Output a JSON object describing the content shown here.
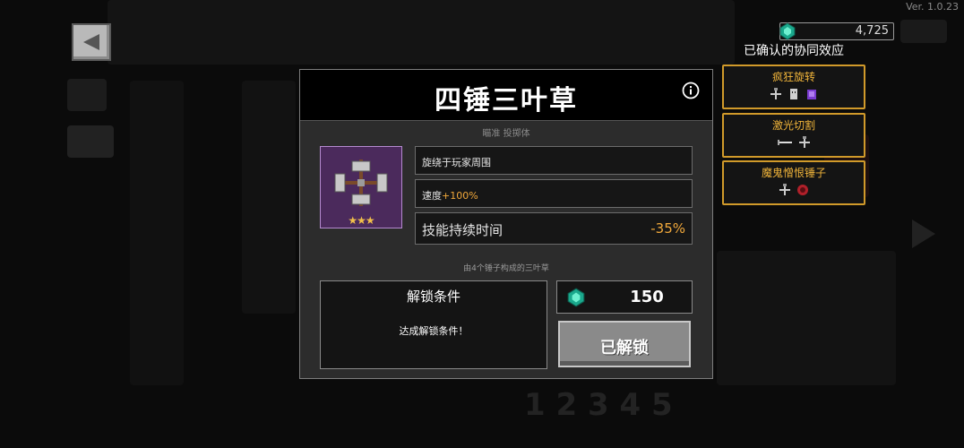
{
  "version": "Ver. 1.0.23",
  "back_button_icon": "back-arrow-icon",
  "currency": {
    "icon": "gem-icon",
    "amount": "4,725"
  },
  "synergy_panel": {
    "title": "已确认的协同效应",
    "items": [
      {
        "name": "疯狂旋转",
        "icons": [
          "hammer-icon",
          "ghost-icon",
          "purple-orb-icon"
        ]
      },
      {
        "name": "激光切割",
        "icons": [
          "laser-icon",
          "hammer-icon"
        ]
      },
      {
        "name": "魔鬼憎恨锤子",
        "icons": [
          "hammer-icon",
          "red-gear-icon"
        ]
      }
    ]
  },
  "dialog": {
    "title": "四锤三叶草",
    "info_icon": "info-icon",
    "tags": "瞄准 投掷体",
    "weapon": {
      "icon": "four-hammer-clover-icon",
      "stars": "★★★"
    },
    "stats": {
      "line1": "旋绕于玩家周围",
      "line2_label": "速度",
      "line2_value": "+100%",
      "line3_label": "技能持续时间",
      "line3_value": "-35%"
    },
    "composed_of": "由4个锤子构成的三叶草",
    "unlock": {
      "title": "解锁条件",
      "desc": "达成解锁条件！"
    },
    "price": {
      "icon": "gem-icon",
      "value": "150"
    },
    "unlocked_button": "已解锁"
  },
  "colors": {
    "accent_orange": "#f2a93b",
    "synergy_border": "#d19a2a",
    "weapon_bg": "#4b2a5c"
  }
}
